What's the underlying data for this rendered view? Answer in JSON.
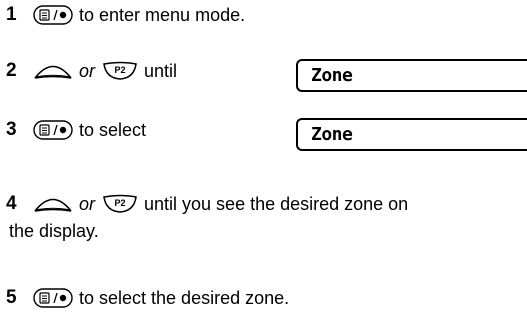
{
  "steps": [
    {
      "number": "1",
      "text": "to enter menu mode."
    },
    {
      "number": "2",
      "or": "or",
      "text": "until",
      "display": "Zone"
    },
    {
      "number": "3",
      "text": "to select",
      "display": "Zone"
    },
    {
      "number": "4",
      "or": "or",
      "text_line1": "until you see the desired zone on",
      "text_line2": "the display."
    },
    {
      "number": "5",
      "text": "to select the desired zone."
    }
  ],
  "icons": {
    "menu": "menu-select-button-icon",
    "scroll": "scroll-up-button-icon",
    "p2": "p2-button-icon"
  },
  "p2_label": "P2"
}
